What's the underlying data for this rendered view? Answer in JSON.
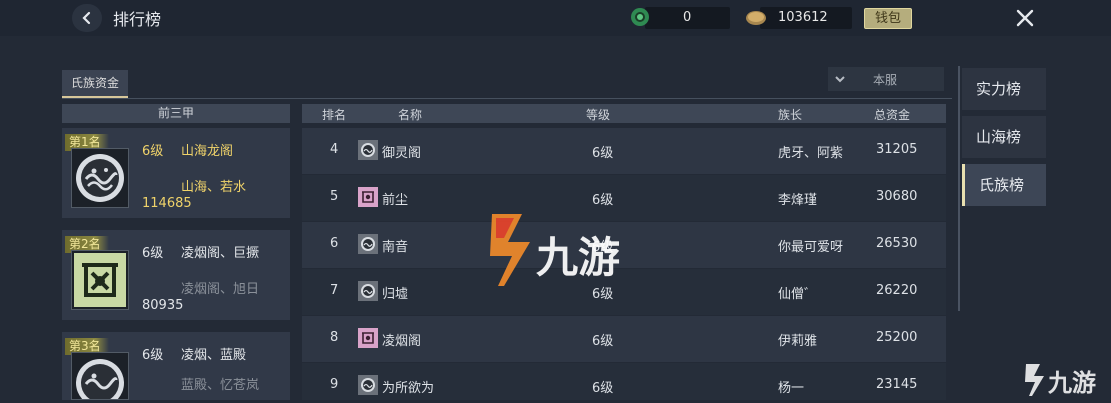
{
  "header": {
    "title": "排行榜",
    "jade_value": "0",
    "coin_value": "103612",
    "wallet_label": "钱包"
  },
  "tabs": {
    "clan_funds": "氏族资金"
  },
  "scope": {
    "selected": "本服"
  },
  "top3": {
    "header": "前三甲",
    "cards": [
      {
        "badge": "第1名",
        "level": "6级",
        "name": "山海龙阁",
        "leaders": "山海、若水",
        "funds": "114685"
      },
      {
        "badge": "第2名",
        "level": "6级",
        "name": "凌烟阁、巨撅",
        "leaders": "凌烟阁、旭日",
        "funds": "80935"
      },
      {
        "badge": "第3名",
        "level": "6级",
        "name": "凌烟、蓝殿",
        "leaders": "蓝殿、忆苍岚",
        "funds": ""
      }
    ]
  },
  "table": {
    "headers": {
      "rank": "排名",
      "name": "名称",
      "level": "等级",
      "leader": "族长",
      "funds": "总资金"
    },
    "rows": [
      {
        "rank": "4",
        "name": "御灵阁",
        "level": "6级",
        "leader": "虎牙、阿紫",
        "funds": "31205"
      },
      {
        "rank": "5",
        "name": "前尘",
        "level": "6级",
        "leader": "李烽瑾",
        "funds": "30680"
      },
      {
        "rank": "6",
        "name": "南音",
        "level": "6级",
        "leader": "你最可爱呀",
        "funds": "26530"
      },
      {
        "rank": "7",
        "name": "归墟",
        "level": "6级",
        "leader": "仙僧゛",
        "funds": "26220"
      },
      {
        "rank": "8",
        "name": "凌烟阁",
        "level": "6级",
        "leader": "伊莉雅",
        "funds": "25200"
      },
      {
        "rank": "9",
        "name": "为所欲为",
        "level": "6级",
        "leader": "杨一",
        "funds": "23145"
      }
    ]
  },
  "side_tabs": [
    "实力榜",
    "山海榜",
    "氏族榜"
  ],
  "watermark": {
    "text": "九游"
  },
  "colors": {
    "gold": "#f0d36a",
    "accent": "#e8e0b0"
  }
}
